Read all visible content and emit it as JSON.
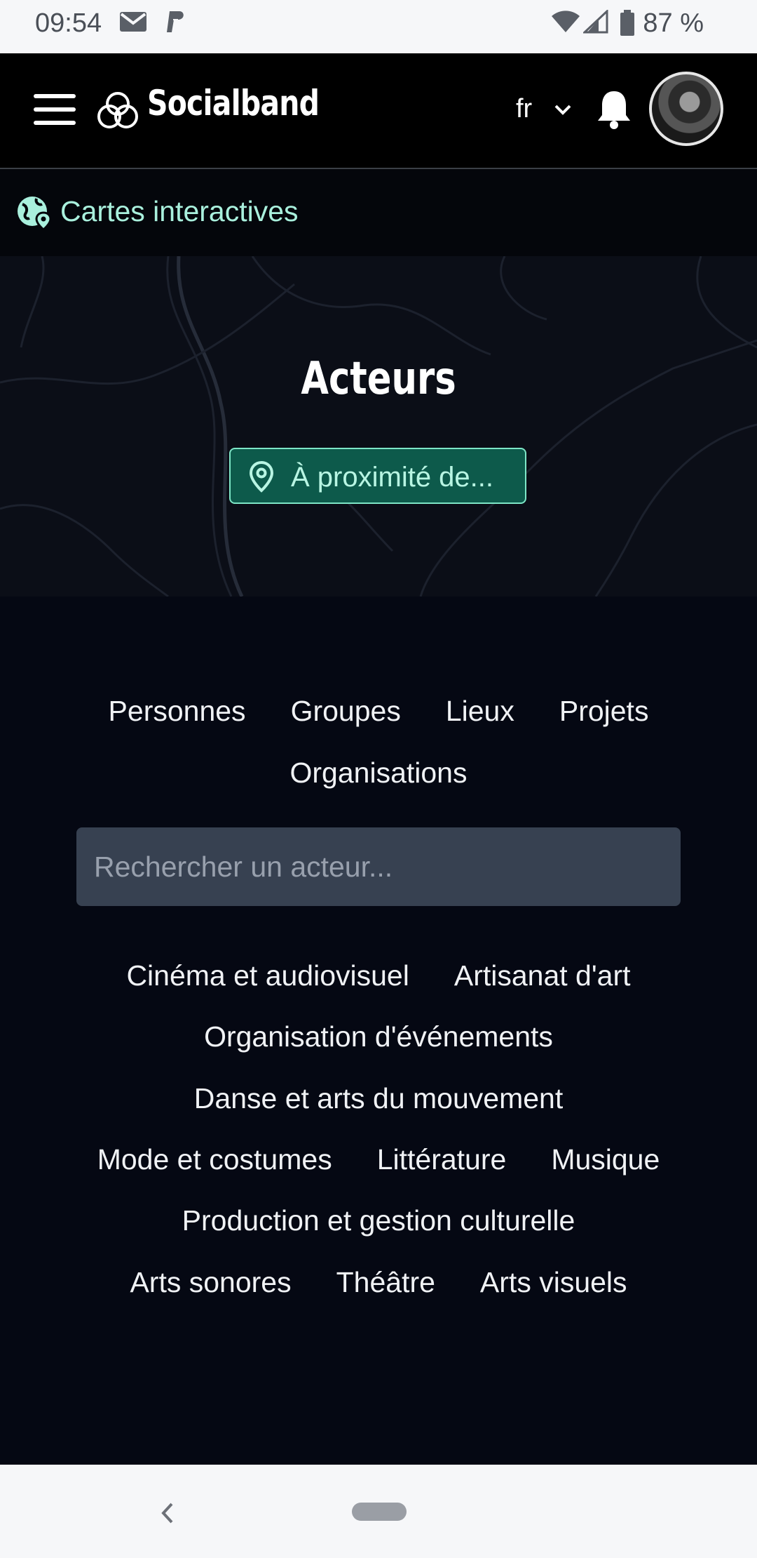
{
  "status_bar": {
    "time": "09:54",
    "icons": [
      "gmail-icon",
      "paypal-icon",
      "wifi-icon",
      "signal-icon",
      "battery-icon"
    ],
    "battery": "87 %"
  },
  "header": {
    "brand": "Socialband",
    "language": "fr",
    "icons": [
      "menu-icon",
      "logo-icon",
      "chevron-down-icon",
      "bell-icon"
    ]
  },
  "maps_link": {
    "label": "Cartes interactives",
    "icon": "globe-pin-icon"
  },
  "hero": {
    "title": "Acteurs",
    "nearby_button": "À proximité de...",
    "accent": "#0d5a4b"
  },
  "types_row1": [
    "Personnes",
    "Groupes",
    "Lieux",
    "Projets"
  ],
  "types_row2": [
    "Organisations"
  ],
  "search": {
    "placeholder": "Rechercher un acteur...",
    "value": ""
  },
  "disciplines": {
    "row1": [
      "Cinéma et audiovisuel",
      "Artisanat d'art"
    ],
    "row2": [
      "Organisation d'événements"
    ],
    "row3": [
      "Danse et arts du mouvement"
    ],
    "row4": [
      "Mode et costumes",
      "Littérature",
      "Musique"
    ],
    "row5": [
      "Production et gestion culturelle"
    ],
    "row6": [
      "Arts sonores",
      "Théâtre",
      "Arts visuels"
    ]
  }
}
